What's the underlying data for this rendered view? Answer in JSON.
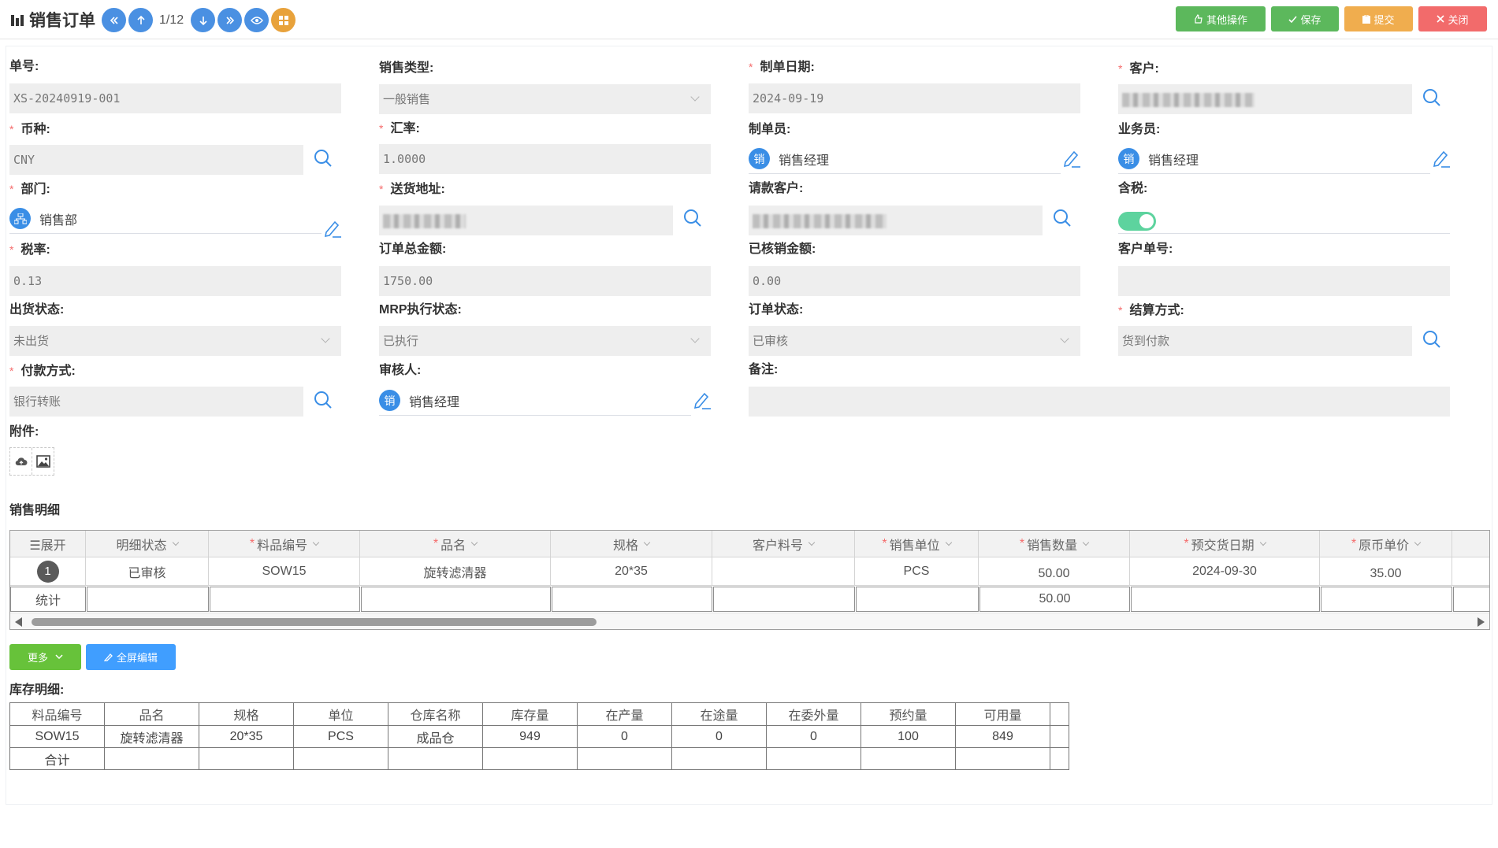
{
  "header": {
    "title": "销售订单",
    "pager": "1/12",
    "actions": {
      "other": "其他操作",
      "save": "保存",
      "submit": "提交",
      "close": "关闭"
    }
  },
  "form": {
    "order_no": {
      "label": "单号:",
      "value": "XS-20240919-001"
    },
    "sales_type": {
      "label": "销售类型:",
      "value": "一般销售"
    },
    "create_date": {
      "label": "制单日期:",
      "value": "2024-09-19"
    },
    "customer": {
      "label": "客户:",
      "value": ""
    },
    "currency": {
      "label": "币种:",
      "value": "CNY"
    },
    "exchange_rate": {
      "label": "汇率:",
      "value": "1.0000"
    },
    "creator": {
      "label": "制单员:",
      "avatar": "销",
      "value": "销售经理"
    },
    "salesperson": {
      "label": "业务员:",
      "avatar": "销",
      "value": "销售经理"
    },
    "department": {
      "label": "部门:",
      "value": "销售部"
    },
    "delivery_address": {
      "label": "送货地址:",
      "value": ""
    },
    "billing_customer": {
      "label": "请款客户:",
      "value": ""
    },
    "tax_included": {
      "label": "含税:",
      "on": true
    },
    "tax_rate": {
      "label": "税率:",
      "value": "0.13"
    },
    "total_amount": {
      "label": "订单总金额:",
      "value": "1750.00"
    },
    "written_off": {
      "label": "已核销金额:",
      "value": "0.00"
    },
    "customer_order_no": {
      "label": "客户单号:",
      "value": ""
    },
    "shipment_status": {
      "label": "出货状态:",
      "value": "未出货"
    },
    "mrp_status": {
      "label": "MRP执行状态:",
      "value": "已执行"
    },
    "order_status": {
      "label": "订单状态:",
      "value": "已审核"
    },
    "settlement": {
      "label": "结算方式:",
      "value": "货到付款"
    },
    "payment_method": {
      "label": "付款方式:",
      "value": "银行转账"
    },
    "reviewer": {
      "label": "审核人:",
      "avatar": "销",
      "value": "销售经理"
    },
    "remarks": {
      "label": "备注:",
      "value": ""
    },
    "attachments": {
      "label": "附件:"
    }
  },
  "detail": {
    "title": "销售明细",
    "columns": [
      {
        "label": "☰展开",
        "required": false,
        "sortable": false
      },
      {
        "label": "明细状态",
        "required": false,
        "sortable": true
      },
      {
        "label": "料品编号",
        "required": true,
        "sortable": true
      },
      {
        "label": "品名",
        "required": true,
        "sortable": true
      },
      {
        "label": "规格",
        "required": false,
        "sortable": true
      },
      {
        "label": "客户料号",
        "required": false,
        "sortable": true
      },
      {
        "label": "销售单位",
        "required": true,
        "sortable": true
      },
      {
        "label": "销售数量",
        "required": true,
        "sortable": true
      },
      {
        "label": "预交货日期",
        "required": true,
        "sortable": true
      },
      {
        "label": "原币单价",
        "required": true,
        "sortable": true
      }
    ],
    "rows": [
      {
        "no": "1",
        "status": "已审核",
        "item_code": "SOW15",
        "name": "旋转滤清器",
        "spec": "20*35",
        "customer_code": "",
        "unit": "PCS",
        "qty": "50.00",
        "delivery_date": "2024-09-30",
        "price": "35.00"
      }
    ],
    "summary": {
      "label": "统计",
      "qty": "50.00"
    },
    "buttons": {
      "more": "更多",
      "fullscreen": "全屏编辑"
    }
  },
  "inventory": {
    "title": "库存明细:",
    "columns": [
      "料品编号",
      "品名",
      "规格",
      "单位",
      "仓库名称",
      "库存量",
      "在产量",
      "在途量",
      "在委外量",
      "预约量",
      "可用量"
    ],
    "rows": [
      [
        "SOW15",
        "旋转滤清器",
        "20*35",
        "PCS",
        "成品仓",
        "949",
        "0",
        "0",
        "0",
        "100",
        "849"
      ]
    ],
    "summary_label": "合计"
  },
  "colors": {
    "primary": "#4a90e2",
    "success": "#5cb85c",
    "warning": "#f0ad4e",
    "danger": "#f26b6b",
    "toggle_on": "#5dd39e",
    "required": "#f56c6c"
  }
}
